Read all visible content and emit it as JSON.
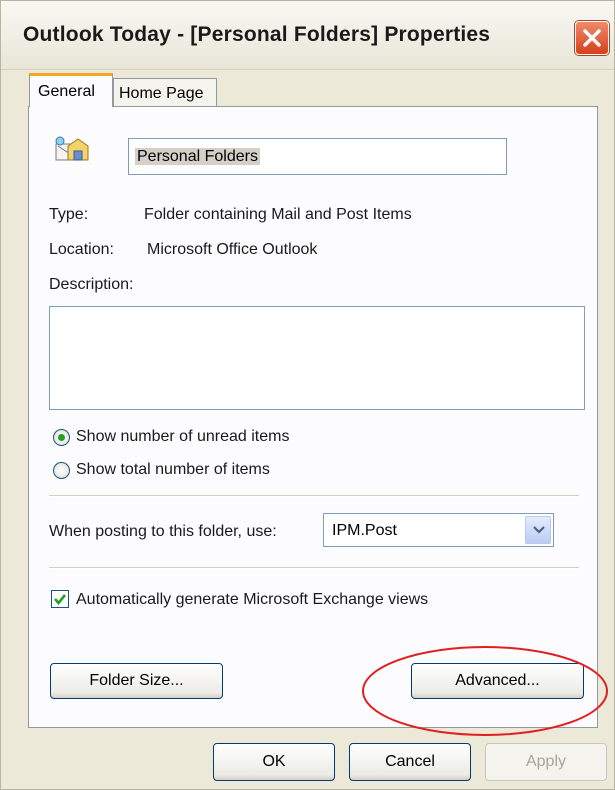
{
  "window": {
    "title": "Outlook Today - [Personal Folders] Properties"
  },
  "tabs": [
    {
      "label": "General",
      "active": true
    },
    {
      "label": "Home Page",
      "active": false
    }
  ],
  "folder": {
    "icon": "folder-properties-icon",
    "name": "Personal Folders",
    "type_label": "Type:",
    "type_value": "Folder containing Mail and Post Items",
    "location_label": "Location:",
    "location_value": "Microsoft Office Outlook",
    "description_label": "Description:",
    "description_value": ""
  },
  "options": {
    "show_unread_label": "Show number of unread items",
    "show_total_label": "Show total number of items",
    "selected": "show_unread"
  },
  "posting": {
    "label": "When posting to this folder, use:",
    "form_value": "IPM.Post"
  },
  "exchange_views": {
    "label": "Automatically generate Microsoft Exchange views",
    "checked": true
  },
  "buttons": {
    "folder_size": "Folder Size...",
    "advanced": "Advanced...",
    "ok": "OK",
    "cancel": "Cancel",
    "apply": "Apply"
  },
  "colors": {
    "window_bg": "#ece9d8",
    "highlight_ellipse": "#e02020",
    "close_button": "#d5401c",
    "radio_dot": "#21a121",
    "checkmark": "#21a121"
  }
}
